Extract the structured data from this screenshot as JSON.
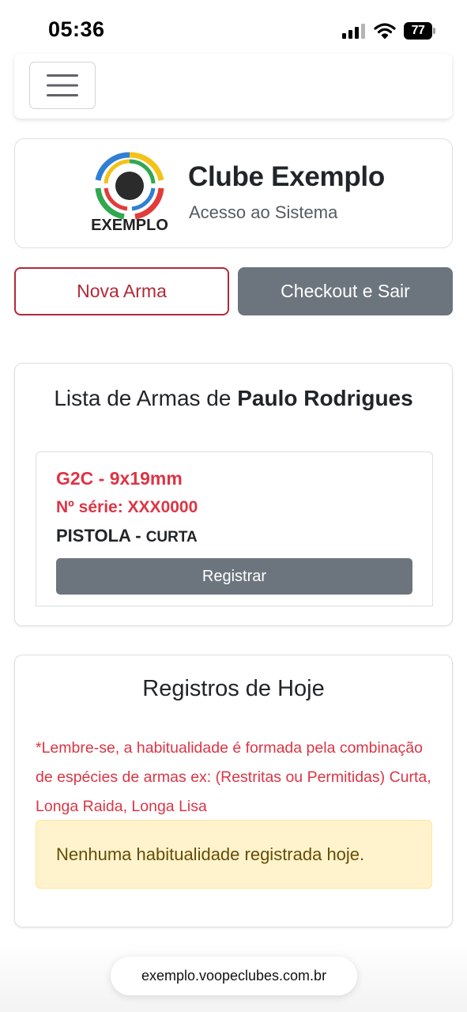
{
  "status_bar": {
    "time": "05:36",
    "battery_level": "77",
    "icons": [
      "signal-icon",
      "wifi-icon",
      "battery-icon"
    ]
  },
  "navbar": {
    "menu_icon": "hamburger-menu-icon"
  },
  "header": {
    "logo_text": "EXEMPLO",
    "club_name": "Clube Exemplo",
    "subtitle": "Acesso ao Sistema"
  },
  "actions": {
    "new_weapon_label": "Nova Arma",
    "checkout_label": "Checkout e Sair"
  },
  "weapons": {
    "title_prefix": "Lista de Armas de ",
    "owner_name": "Paulo Rodrigues",
    "items": [
      {
        "model": "G2C - 9x19mm",
        "serial": "Nº série: XXX0000",
        "type": "PISTOLA - ",
        "length": "CURTA",
        "register_label": "Registrar"
      }
    ]
  },
  "today": {
    "title": "Registros de Hoje",
    "reminder": "*Lembre-se, a habitualidade é formada pela combinação de espécies de armas ex: (Restritas ou Permitidas) Curta, Longa Raida, Longa Lisa",
    "empty_message": "Nenhuma habitualidade registrada hoje."
  },
  "browser": {
    "url": "exemplo.voopeclubes.com.br"
  },
  "colors": {
    "danger": "#dc3545",
    "danger_border": "#b02a37",
    "secondary": "#6c757d",
    "warning_bg": "#fff3cd",
    "warning_text": "#664d03"
  }
}
